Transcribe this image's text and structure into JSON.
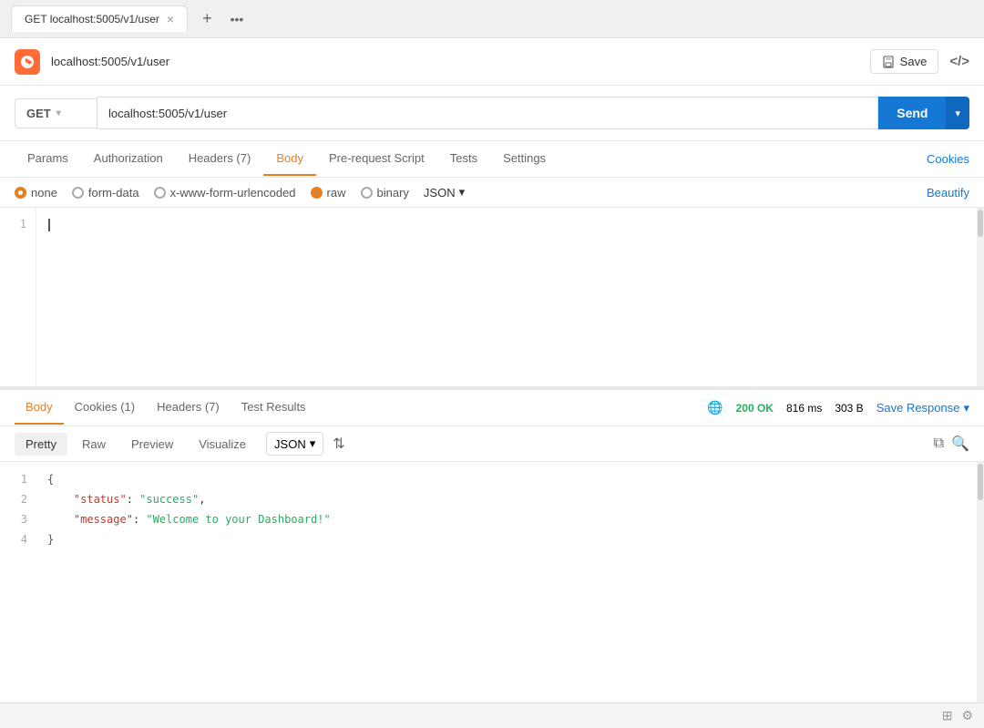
{
  "browser": {
    "tab_label": "GET localhost:5005/v1/user",
    "tab_add": "+",
    "tab_more": "•••"
  },
  "topbar": {
    "url": "localhost:5005/v1/user",
    "save_label": "Save",
    "code_label": "</>"
  },
  "request": {
    "method": "GET",
    "url": "localhost:5005/v1/user",
    "send_label": "Send"
  },
  "tabs": {
    "items": [
      "Params",
      "Authorization",
      "Headers (7)",
      "Body",
      "Pre-request Script",
      "Tests",
      "Settings"
    ],
    "active": "Body",
    "cookies_label": "Cookies"
  },
  "body_options": {
    "options": [
      "none",
      "form-data",
      "x-www-form-urlencoded",
      "raw",
      "binary"
    ],
    "active": "none",
    "format": "JSON",
    "beautify_label": "Beautify"
  },
  "code_editor": {
    "line_numbers": [
      "1"
    ],
    "content": ""
  },
  "response_tabs": {
    "items": [
      "Body",
      "Cookies (1)",
      "Headers (7)",
      "Test Results"
    ],
    "active": "Body",
    "status": {
      "code": "200 OK",
      "time": "816 ms",
      "size": "303 B"
    },
    "save_response_label": "Save Response"
  },
  "response_format": {
    "tabs": [
      "Pretty",
      "Raw",
      "Preview",
      "Visualize"
    ],
    "active": "Pretty",
    "format": "JSON"
  },
  "response_body": {
    "line_numbers": [
      "1",
      "2",
      "3",
      "4"
    ],
    "lines": [
      "{",
      "    \"status\": \"success\",",
      "    \"message\": \"Welcome to your Dashboard!\"",
      "}"
    ]
  },
  "bottom_bar": {
    "grid_icon": "⊞",
    "settings_icon": "⚙"
  }
}
